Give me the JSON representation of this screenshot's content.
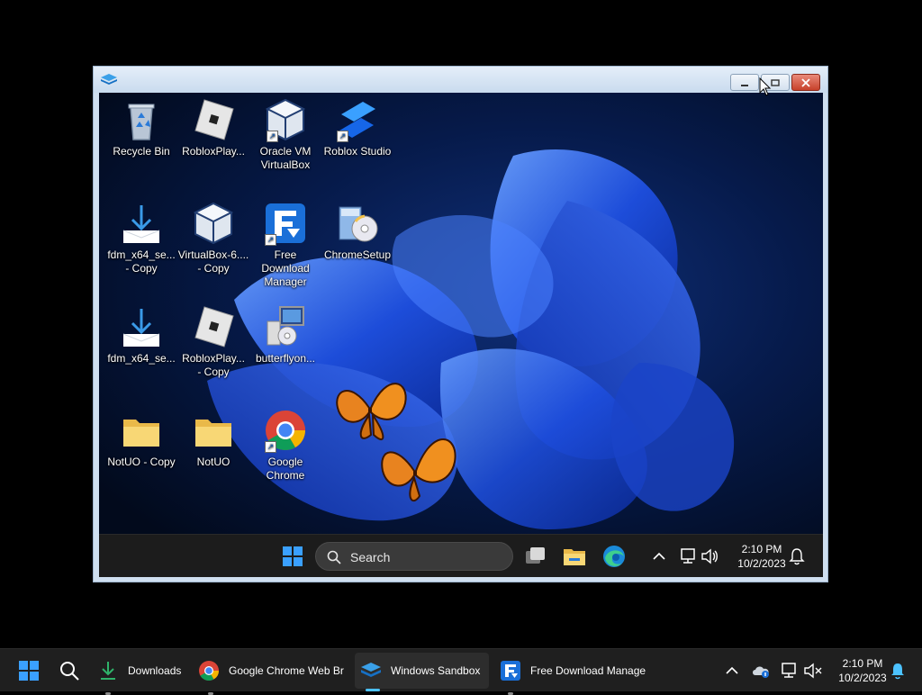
{
  "guest_desktop": {
    "icons": [
      {
        "label": "Recycle Bin"
      },
      {
        "label": "RobloxPlay..."
      },
      {
        "label": "Oracle VM\nVirtualBox"
      },
      {
        "label": "Roblox Studio"
      },
      {
        "label": "fdm_x64_se...\n- Copy"
      },
      {
        "label": "VirtualBox-6....\n- Copy"
      },
      {
        "label": "Free\nDownload\nManager"
      },
      {
        "label": "ChromeSetup"
      },
      {
        "label": "fdm_x64_se..."
      },
      {
        "label": "RobloxPlay...\n- Copy"
      },
      {
        "label": "butterflyon..."
      },
      {
        "label": "NotUO - Copy"
      },
      {
        "label": "NotUO"
      },
      {
        "label": "Google\nChrome"
      }
    ]
  },
  "guest_taskbar": {
    "search_placeholder": "Search",
    "time": "2:10 PM",
    "date": "10/2/2023"
  },
  "host_taskbar": {
    "items": [
      {
        "label": "Downloads",
        "icon": "download-arrow-icon"
      },
      {
        "label": "Google Chrome Web Br",
        "icon": "chrome-icon"
      },
      {
        "label": "Windows Sandbox",
        "icon": "sandbox-icon",
        "active": true
      },
      {
        "label": "Free Download Manage",
        "icon": "fdm-icon"
      }
    ],
    "time": "2:10 PM",
    "date": "10/2/2023"
  },
  "colors": {
    "wallpaper_blue": "#1f4ee0",
    "accent": "#4cc2ff",
    "taskbar": "#1f1f1f"
  }
}
